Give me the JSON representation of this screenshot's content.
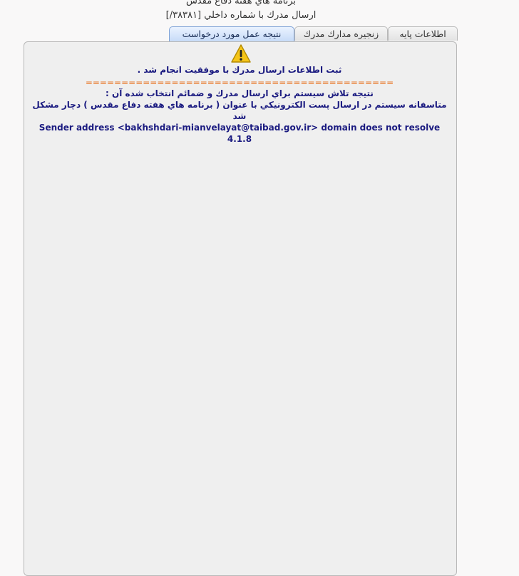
{
  "header": {
    "title": "برنامه هاي هفته دفاع مقدس",
    "subtitle": "ارسال مدرك با شماره داخلي [۳۸۳۸۱/]"
  },
  "tabs": [
    {
      "label": "اطلاعات پايه"
    },
    {
      "label": "زنجيره مدارك مدرك"
    },
    {
      "label": "نتيجه عمل مورد درخواست"
    }
  ],
  "result": {
    "icon": "warning-icon",
    "success_message": "ثبت اطلاعات ارسال مدرك با موفقيت انجام شد .",
    "separator": "===========================================",
    "send_attempt_heading": "نتيجه تلاش سيستم براي ارسال مدرك و ضمائم انتخاب شده آن :",
    "email_error_message": "متاسفانه سيستم در ارسال پست الكترونيكي با عنوان ( برنامه هاي هفته دفاع مقدس ) دچار مشكل شد",
    "error_detail": "Sender address <bakhshdari-mianvelayat@taibad.gov.ir> domain does not resolve 4.1.8"
  },
  "colors": {
    "message_text": "#1a1a80",
    "separator": "#e8782a",
    "warning_fill": "#f5c518"
  }
}
